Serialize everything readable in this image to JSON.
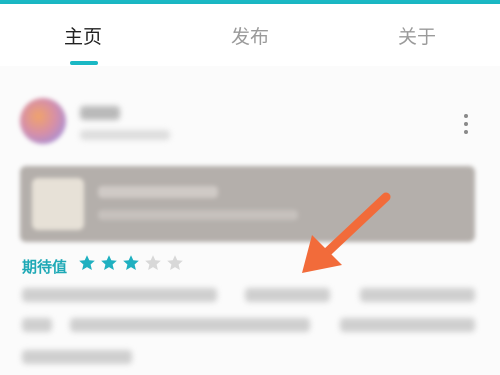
{
  "tabs": [
    {
      "label": "主页",
      "active": true
    },
    {
      "label": "发布",
      "active": false
    },
    {
      "label": "关于",
      "active": false
    }
  ],
  "accent_color": "#1ab8c4",
  "rating": {
    "label": "期待值",
    "value": 3,
    "max": 5,
    "filled_color": "#1fb0c0",
    "empty_color": "#d8d8d8"
  },
  "arrow_color": "#f26b3a",
  "icons": {
    "more": "more-vertical-icon",
    "star": "star-icon",
    "arrow": "arrow-pointer-icon"
  }
}
